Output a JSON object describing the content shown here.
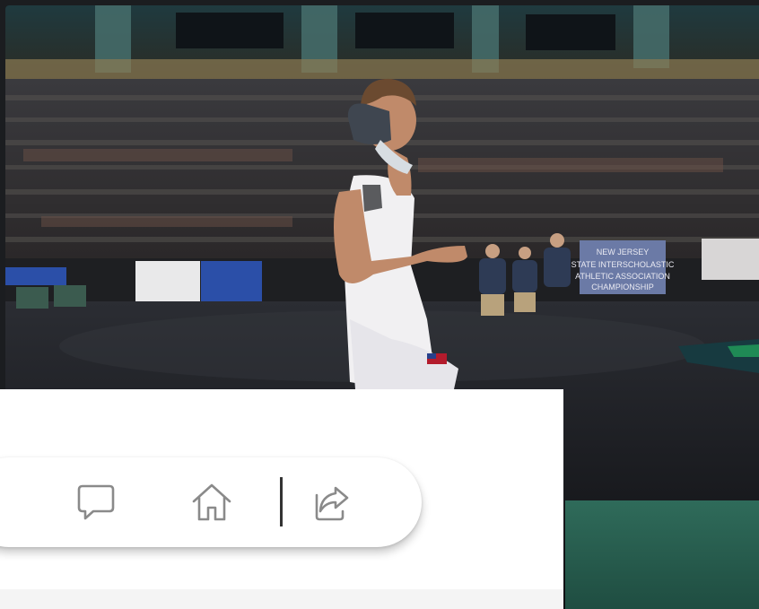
{
  "photo": {
    "alt": "Wrestler walking onto the mat in a packed arena",
    "banner_text": "NEW JERSEY STATE INTERSCHOLASTIC ATHLETIC ASSOCIATION CHAMPIONSHIP",
    "left_banner_text": "NEW JERSEY"
  },
  "actions": {
    "comment_icon": "comment-icon",
    "home_icon": "home-icon",
    "share_icon": "share-icon"
  },
  "colors": {
    "page_bg": "#1b1d20",
    "panel_bg": "#ffffff",
    "icon": "#8a8a8a",
    "divider": "#333333"
  }
}
